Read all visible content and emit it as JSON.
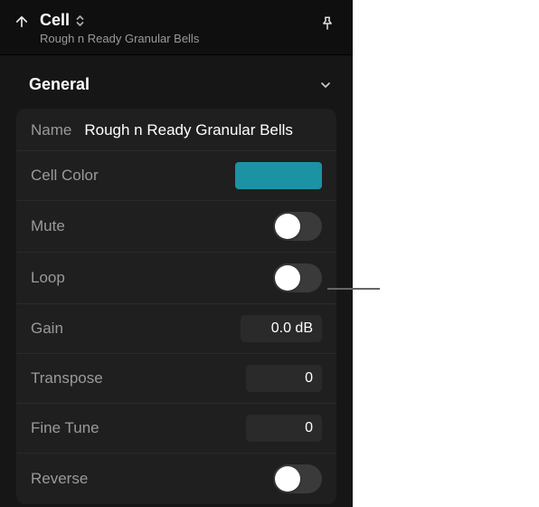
{
  "header": {
    "title": "Cell",
    "subtitle": "Rough n Ready Granular Bells"
  },
  "section": {
    "title": "General"
  },
  "rows": {
    "name": {
      "label": "Name",
      "value": "Rough n Ready Granular Bells"
    },
    "cellcolor": {
      "label": "Cell Color",
      "swatch": "#1b93a4"
    },
    "mute": {
      "label": "Mute",
      "on": false
    },
    "loop": {
      "label": "Loop",
      "on": false
    },
    "gain": {
      "label": "Gain",
      "value": "0.0 dB"
    },
    "transpose": {
      "label": "Transpose",
      "value": "0"
    },
    "finetune": {
      "label": "Fine Tune",
      "value": "0"
    },
    "reverse": {
      "label": "Reverse",
      "on": false
    }
  }
}
